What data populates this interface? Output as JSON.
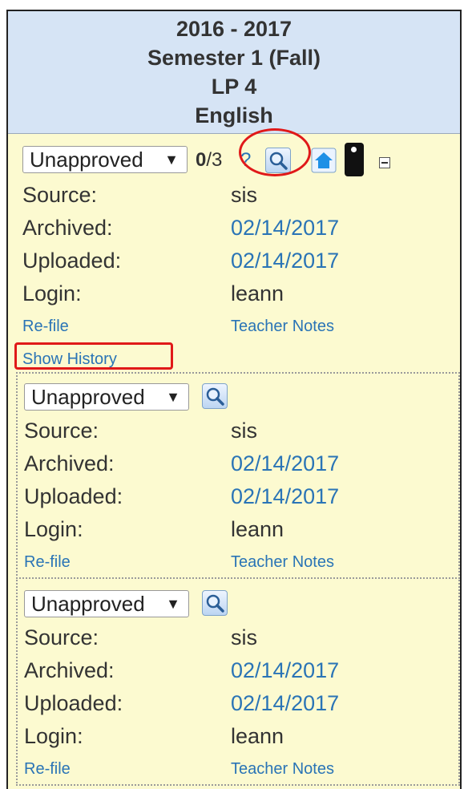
{
  "header": {
    "year": "2016 - 2017",
    "semester": "Semester 1 (Fall)",
    "lp": "LP 4",
    "subject": "English"
  },
  "records": [
    {
      "status": "Unapproved",
      "count_bold": "0",
      "count_rest": "/3",
      "help": "?",
      "labels": {
        "source": "Source:",
        "archived": "Archived:",
        "uploaded": "Uploaded:",
        "login": "Login:"
      },
      "source": "sis",
      "archived": "02/14/2017",
      "uploaded": "02/14/2017",
      "login": "leann",
      "refile": "Re-file",
      "teacher_notes": "Teacher Notes",
      "show_history": "Show History"
    },
    {
      "status": "Unapproved",
      "labels": {
        "source": "Source:",
        "archived": "Archived:",
        "uploaded": "Uploaded:",
        "login": "Login:"
      },
      "source": "sis",
      "archived": "02/14/2017",
      "uploaded": "02/14/2017",
      "login": "leann",
      "refile": "Re-file",
      "teacher_notes": "Teacher Notes"
    },
    {
      "status": "Unapproved",
      "labels": {
        "source": "Source:",
        "archived": "Archived:",
        "uploaded": "Uploaded:",
        "login": "Login:"
      },
      "source": "sis",
      "archived": "02/14/2017",
      "uploaded": "02/14/2017",
      "login": "leann",
      "refile": "Re-file",
      "teacher_notes": "Teacher Notes"
    }
  ],
  "colors": {
    "header_bg": "#d6e4f5",
    "panel_bg": "#fcfad0",
    "link": "#2a74b6",
    "highlight": "#e01919"
  },
  "icons": [
    "magnifier-icon",
    "home-icon",
    "phone-icon",
    "collapse-icon"
  ]
}
